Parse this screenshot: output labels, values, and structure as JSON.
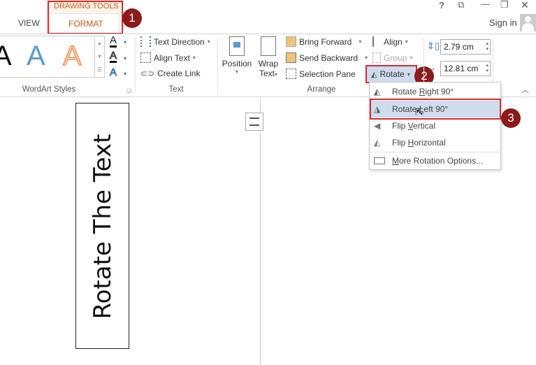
{
  "window": {
    "help": "?",
    "ribbon_display": "⧉",
    "minimize": "—",
    "restore": "❐",
    "close": "✕",
    "sign_in": "Sign in"
  },
  "tabs": {
    "view": "VIEW",
    "context_group": "DRAWING TOOLS",
    "format": "FORMAT"
  },
  "wordart": {
    "group_label": "WordArt Styles",
    "samples": [
      "A",
      "A",
      "A"
    ],
    "text_fill": "A",
    "text_outline": "A",
    "text_effects": "A"
  },
  "text_group": {
    "label": "Text",
    "text_direction": "Text Direction",
    "align_text": "Align Text",
    "create_link": "Create Link"
  },
  "arrange": {
    "label": "Arrange",
    "position": "Position",
    "wrap_text_1": "Wrap",
    "wrap_text_2": "Text",
    "bring_forward": "Bring Forward",
    "send_backward": "Send Backward",
    "selection_pane": "Selection Pane",
    "align": "Align",
    "group": "Group",
    "rotate": "Rotate"
  },
  "size": {
    "height": "2.79 cm",
    "width": "12.81 cm"
  },
  "rotate_menu": {
    "items": [
      {
        "pre": "Rotate ",
        "u": "R",
        "post": "ight 90°"
      },
      {
        "pre": "Rotate ",
        "u": "L",
        "post": "eft 90°"
      },
      {
        "pre": "Flip ",
        "u": "V",
        "post": "ertical"
      },
      {
        "pre": "Flip ",
        "u": "H",
        "post": "orizontal"
      },
      {
        "pre": "",
        "u": "M",
        "post": "ore Rotation Options..."
      }
    ]
  },
  "callouts": [
    "1",
    "2",
    "3"
  ],
  "document": {
    "textbox_text": "Rotate The Text"
  },
  "colors": {
    "accent_orange": "#c55a11",
    "callout": "#8b1a1a",
    "highlight": "#e0262b",
    "selected": "#cfdcee"
  }
}
